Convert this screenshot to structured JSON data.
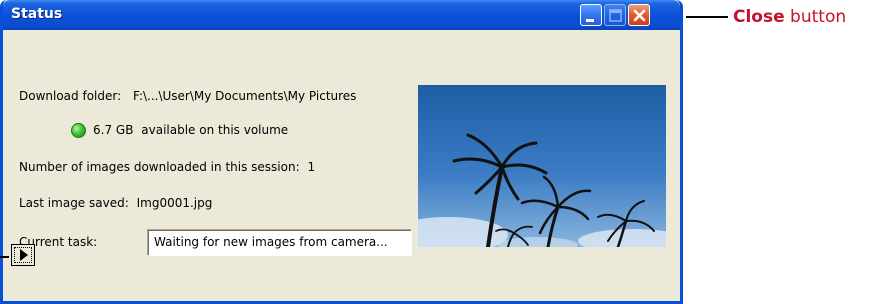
{
  "window": {
    "title": "Status",
    "controls": {
      "minimize": "minimize-icon",
      "maximize": "maximize-icon",
      "close": "close-icon"
    }
  },
  "status": {
    "download_folder_label": "Download folder:",
    "download_folder_value": "F:\\...\\User\\My Documents\\My Pictures",
    "space_value": "6.7 GB",
    "space_text": "available on this volume",
    "images_label": "Number of images downloaded in this session:",
    "images_count": "1",
    "last_saved_label": "Last image saved:",
    "last_saved_value": "Img0001.jpg",
    "task_label": "Current task:",
    "task_value": "Waiting for new images from camera..."
  },
  "annotation": {
    "callout_bold": "Close",
    "callout_rest": " button"
  },
  "colors": {
    "titlebar": "#0a52d8",
    "window_bg": "#ece9d8",
    "callout": "#c8102e",
    "status_ok": "#3fc236"
  }
}
